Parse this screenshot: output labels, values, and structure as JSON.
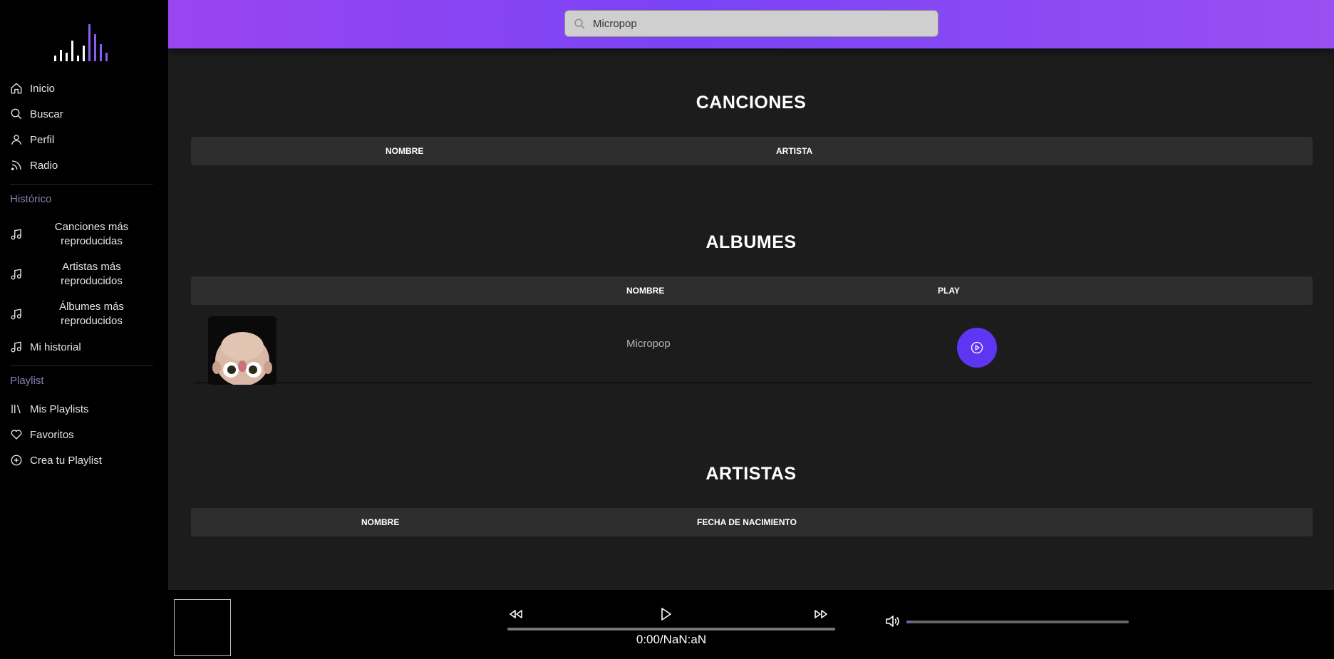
{
  "sidebar": {
    "nav": [
      {
        "label": "Inicio",
        "icon": "home-icon"
      },
      {
        "label": "Buscar",
        "icon": "search-icon"
      },
      {
        "label": "Perfil",
        "icon": "user-icon"
      },
      {
        "label": "Radio",
        "icon": "rss-icon"
      }
    ],
    "historico_label": "Histórico",
    "historico": [
      {
        "label": "Canciones más reproducidas",
        "icon": "music-note-icon"
      },
      {
        "label": "Artistas más reproducidos",
        "icon": "music-note-icon"
      },
      {
        "label": "Álbumes más reproducidos",
        "icon": "music-note-icon"
      },
      {
        "label": "Mi historial",
        "icon": "music-note-icon"
      }
    ],
    "playlist_label": "Playlist",
    "playlist": [
      {
        "label": "Mis Playlists",
        "icon": "library-icon"
      },
      {
        "label": "Favoritos",
        "icon": "heart-icon"
      },
      {
        "label": "Crea tu Playlist",
        "icon": "plus-circle-icon"
      }
    ]
  },
  "search": {
    "value": "Micropop"
  },
  "canciones": {
    "title": "CANCIONES",
    "columns": [
      "NOMBRE",
      "ARTISTA"
    ]
  },
  "albumes": {
    "title": "ALBUMES",
    "columns": [
      "NOMBRE",
      "PLAY"
    ],
    "rows": [
      {
        "name": "Micropop"
      }
    ]
  },
  "artistas": {
    "title": "ARTISTAS",
    "columns": [
      "NOMBRE",
      "FECHA DE NACIMIENTO"
    ]
  },
  "player": {
    "time": "0:00/NaN:aN",
    "volume_fraction": 0.01
  },
  "colors": {
    "accent": "#5e35f2",
    "header_gradient_start": "#9a45f0",
    "header_gradient_end": "#9a4ff2",
    "section_label": "#8c7fb3"
  }
}
